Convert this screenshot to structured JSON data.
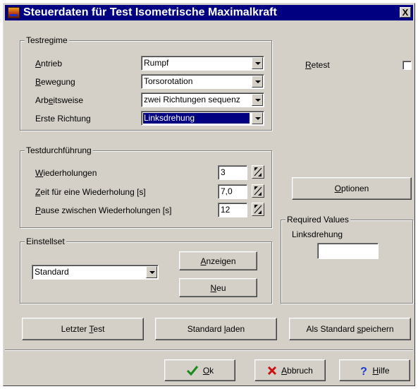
{
  "window": {
    "title": "Steuerdaten für Test Isometrische Maximalkraft",
    "close_label": "X"
  },
  "testregime": {
    "legend": "Testregime",
    "rows": [
      {
        "label_ul": "A",
        "label_rest": "ntrieb",
        "value": "Rumpf"
      },
      {
        "label_ul": "B",
        "label_rest": "ewegung",
        "value": "Torsorotation"
      },
      {
        "label_pre": "Arb",
        "label_ul": "e",
        "label_rest": "itsweise",
        "value": "zwei Richtungen sequenz"
      },
      {
        "label": "Erste Richtung",
        "value": "Linksdrehung"
      }
    ]
  },
  "retest": {
    "label_ul": "R",
    "label_rest": "etest",
    "checked": false
  },
  "testdurchfuehrung": {
    "legend": "Testdurchführung",
    "rows": [
      {
        "label_ul": "W",
        "label_rest": "iederholungen",
        "value": "3"
      },
      {
        "label_ul": "Z",
        "label_rest": "eit für eine Wiederholung [s]",
        "value": "7,0"
      },
      {
        "label_ul": "P",
        "label_rest": "ause zwischen Wiederholungen [s]",
        "value": "12"
      }
    ]
  },
  "optionen_button": {
    "label_ul": "O",
    "label_rest": "ptionen"
  },
  "einstellset": {
    "legend": "Einstellset",
    "value": "Standard",
    "anzeigen": {
      "label_ul": "A",
      "label_rest": "nzeigen"
    },
    "neu": {
      "label_ul": "N",
      "label_rest": "eu"
    }
  },
  "required_values": {
    "legend": "Required Values",
    "label": "Linksdrehung",
    "value": ""
  },
  "bottom_buttons": {
    "letzter_test": {
      "pre": "Letzter ",
      "ul": "T",
      "rest": "est"
    },
    "standard_laden": {
      "pre": "Standard ",
      "ul": "l",
      "rest": "aden"
    },
    "als_standard": {
      "pre": "Als Standard ",
      "ul": "s",
      "rest": "peichern"
    }
  },
  "dialog_buttons": {
    "ok": {
      "ul": "O",
      "rest": "k",
      "icon": "checkmark-icon"
    },
    "abbruch": {
      "ul": "A",
      "rest": "bbruch",
      "icon": "cross-icon"
    },
    "hilfe": {
      "ul": "H",
      "rest": "ilfe",
      "icon": "question-icon"
    }
  },
  "colors": {
    "titlebar": "#000080",
    "face": "#d4d0c8",
    "selection": "#000080",
    "ok_check": "#1a8a1a",
    "cancel_cross": "#cc1111",
    "help_question": "#1a3acc"
  }
}
